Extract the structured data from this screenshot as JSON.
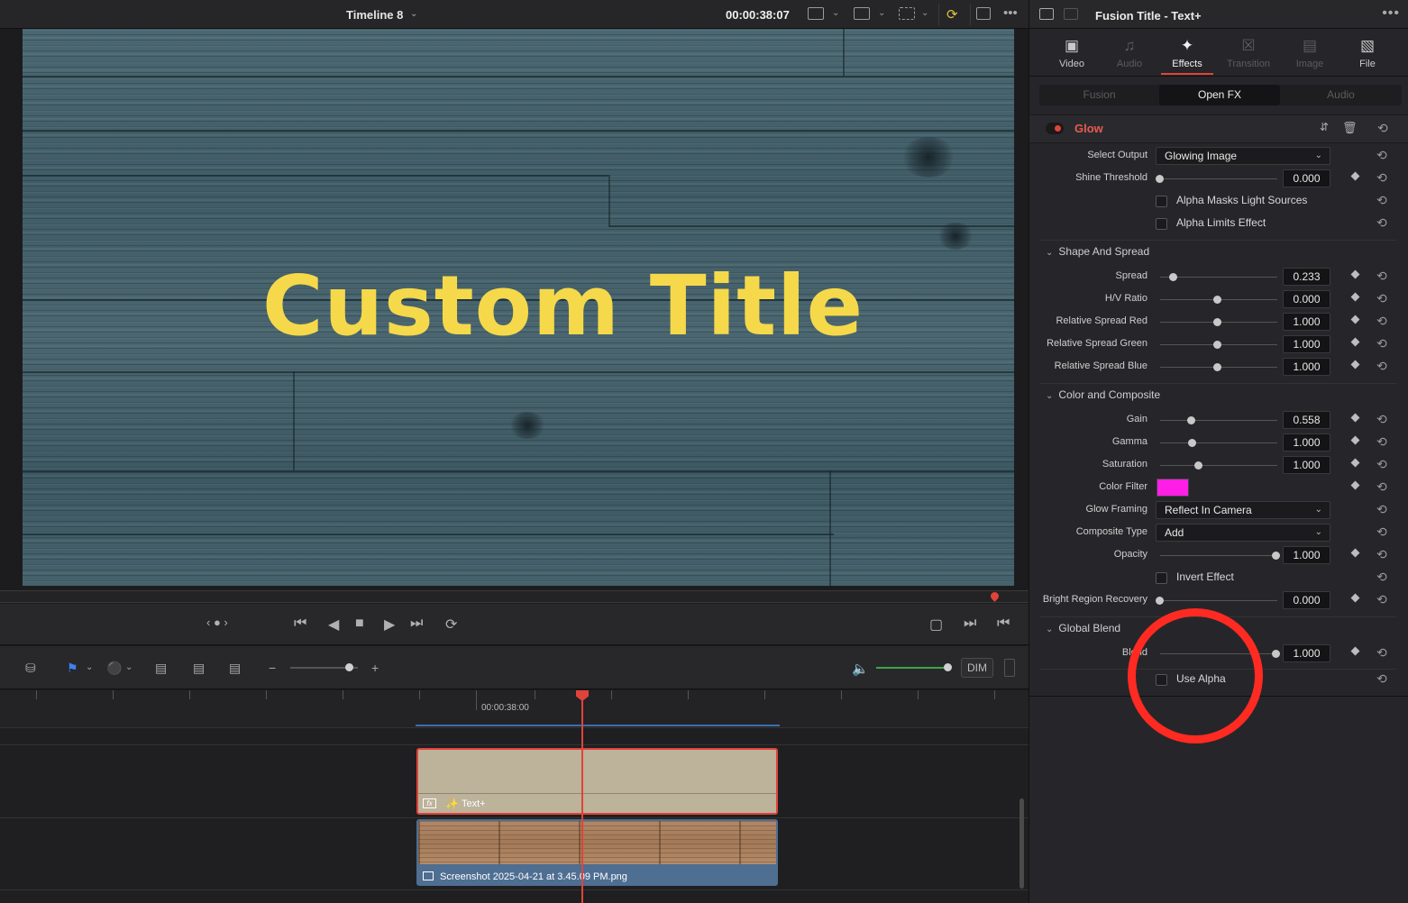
{
  "viewer": {
    "timeline_name": "Timeline 8",
    "timecode": "00:00:38:07",
    "canvas_title": "Custom Title"
  },
  "timeline": {
    "ruler_timecode": "00:00:38:00",
    "text_clip_label": "Text+",
    "image_clip_label": "Screenshot 2025-04-21 at 3.45.09 PM.png",
    "dim_label": "DIM"
  },
  "inspector": {
    "title": "Fusion Title - Text+",
    "tabs": [
      {
        "label": "Video",
        "state": "normal",
        "icon": "video-icon"
      },
      {
        "label": "Audio",
        "state": "disabled",
        "icon": "audio-icon"
      },
      {
        "label": "Effects",
        "state": "active",
        "icon": "effects-wand-icon"
      },
      {
        "label": "Transition",
        "state": "disabled",
        "icon": "transition-icon"
      },
      {
        "label": "Image",
        "state": "disabled",
        "icon": "image-icon"
      },
      {
        "label": "File",
        "state": "normal",
        "icon": "file-icon"
      }
    ],
    "subtabs": [
      "Fusion",
      "Open FX",
      "Audio"
    ],
    "effect_name": "Glow",
    "select_output": {
      "label": "Select Output",
      "value": "Glowing Image"
    },
    "shine_threshold": {
      "label": "Shine Threshold",
      "value": "0.000"
    },
    "alpha_masks": "Alpha Masks Light Sources",
    "alpha_limits": "Alpha Limits Effect",
    "group_shape": "Shape And Spread",
    "spread": {
      "label": "Spread",
      "value": "0.233"
    },
    "hv_ratio": {
      "label": "H/V Ratio",
      "value": "0.000"
    },
    "rel_red": {
      "label": "Relative Spread Red",
      "value": "1.000"
    },
    "rel_green": {
      "label": "Relative Spread Green",
      "value": "1.000"
    },
    "rel_blue": {
      "label": "Relative Spread Blue",
      "value": "1.000"
    },
    "group_color": "Color and Composite",
    "gain": {
      "label": "Gain",
      "value": "0.558"
    },
    "gamma": {
      "label": "Gamma",
      "value": "1.000"
    },
    "saturation": {
      "label": "Saturation",
      "value": "1.000"
    },
    "color_filter": {
      "label": "Color Filter",
      "color": "#ff1ee6"
    },
    "glow_framing": {
      "label": "Glow Framing",
      "value": "Reflect In Camera"
    },
    "composite_type": {
      "label": "Composite Type",
      "value": "Add"
    },
    "opacity": {
      "label": "Opacity",
      "value": "1.000"
    },
    "invert_effect": "Invert Effect",
    "bright_region": {
      "label": "Bright Region Recovery",
      "value": "0.000"
    },
    "group_global": "Global Blend",
    "blend": {
      "label": "Blend",
      "value": "1.000"
    },
    "use_alpha": "Use Alpha"
  },
  "colors": {
    "accent": "#e0433a",
    "annotation": "#ff2a22",
    "title_yellow": "#f5d94a"
  }
}
